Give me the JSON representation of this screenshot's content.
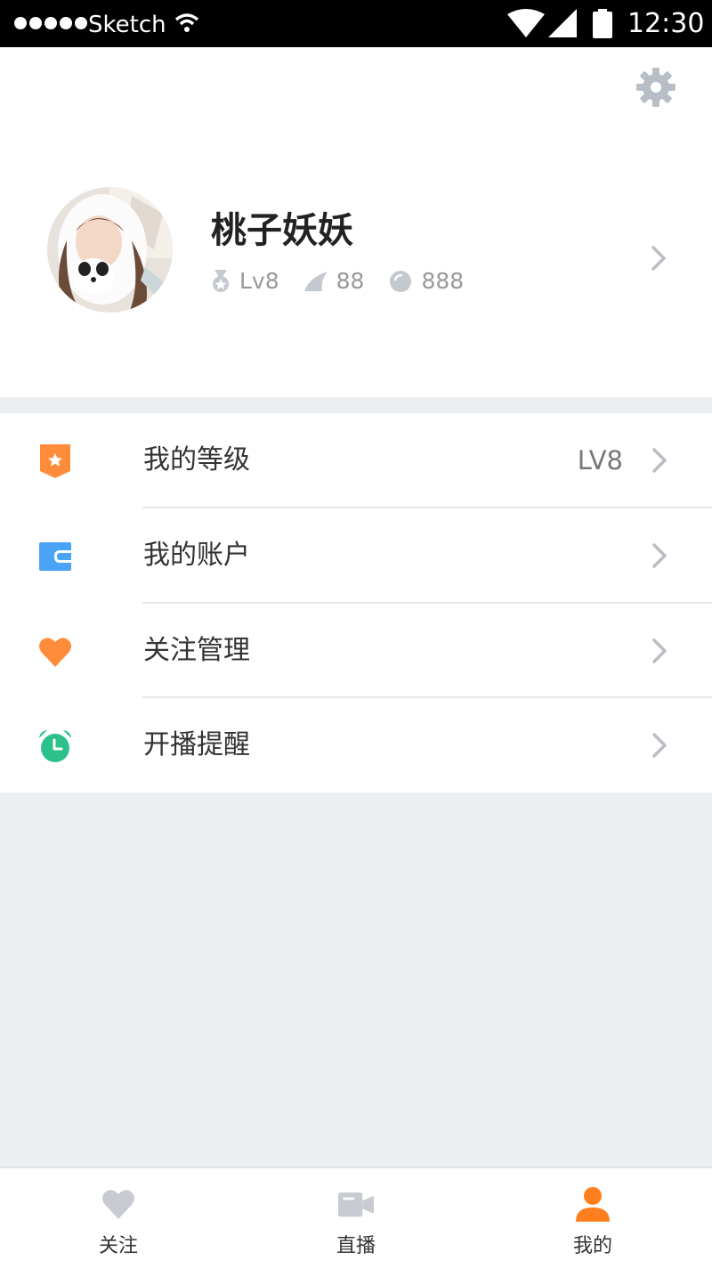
{
  "status_bar": {
    "carrier": "Sketch",
    "time": "12:30"
  },
  "profile": {
    "username": "桃子妖妖",
    "level": "Lv8",
    "fans": "88",
    "coins": "888"
  },
  "menu": {
    "items": [
      {
        "label": "我的等级",
        "value": "LV8",
        "icon": "level-badge-icon",
        "color": "#ff8c3a"
      },
      {
        "label": "我的账户",
        "value": "",
        "icon": "wallet-icon",
        "color": "#4aa3f5"
      },
      {
        "label": "关注管理",
        "value": "",
        "icon": "heart-icon",
        "color": "#ff8c3a"
      },
      {
        "label": "开播提醒",
        "value": "",
        "icon": "alarm-clock-icon",
        "color": "#2ec08a"
      }
    ]
  },
  "tabbar": {
    "tabs": [
      {
        "label": "关注",
        "icon": "heart-icon",
        "active": false
      },
      {
        "label": "直播",
        "icon": "video-camera-icon",
        "active": false
      },
      {
        "label": "我的",
        "icon": "user-icon",
        "active": true
      }
    ],
    "active_color": "#ff7f1f",
    "inactive_color": "#c8ccd2"
  }
}
